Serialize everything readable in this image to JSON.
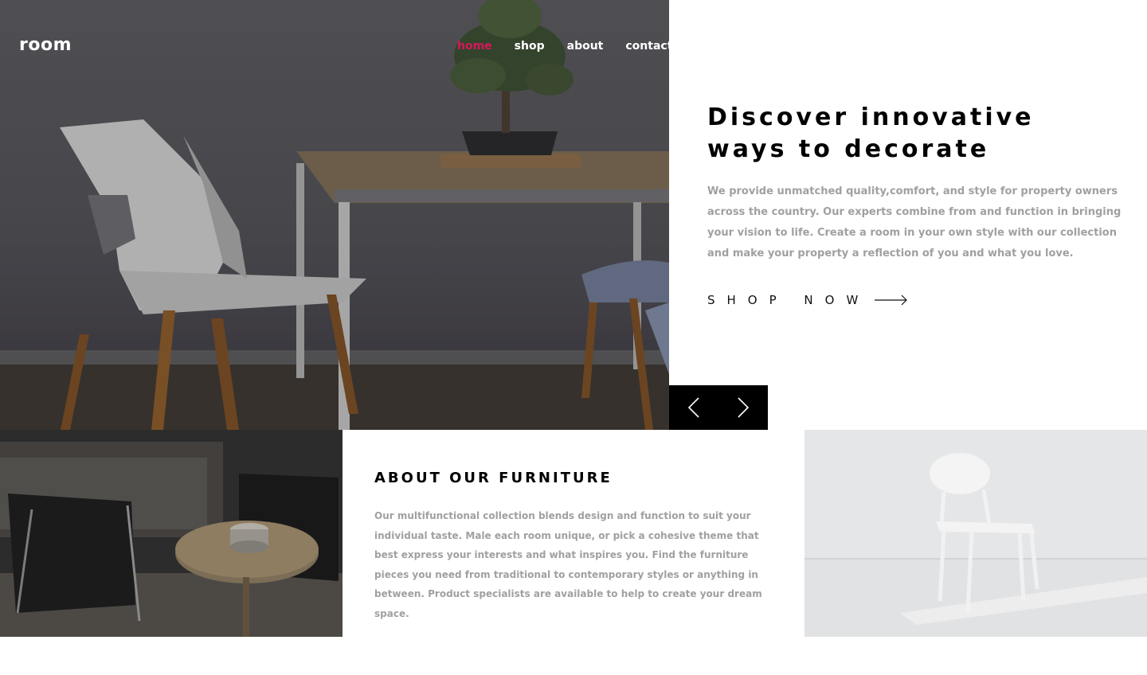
{
  "header": {
    "logo": "room",
    "nav": [
      {
        "label": "home",
        "active": true
      },
      {
        "label": "shop",
        "active": false
      },
      {
        "label": "about",
        "active": false
      },
      {
        "label": "contact",
        "active": false
      }
    ]
  },
  "hero": {
    "headline": "Discover innovative ways to decorate",
    "description": "We provide unmatched quality,comfort, and style for property owners across the country. Our experts combine from and function in bringing your vision to life. Create a room in your own style with our collection and make your property a reflection of you and what you love.",
    "cta": "SHOP NOW",
    "icons": {
      "cta": "arrow-right-icon",
      "prev": "chevron-left-icon",
      "next": "chevron-right-icon"
    }
  },
  "about": {
    "title": "ABOUT OUR FURNITURE",
    "description": "Our multifunctional collection blends design and function to suit your individual taste. Male each room unique, or pick a cohesive theme that best express your interests and what inspires you. Find the furniture pieces you need from traditional to contemporary styles or anything in between. Product specialists are available to help to create your dream space."
  },
  "colors": {
    "accent": "#d6175a",
    "text_dark": "#000000",
    "text_muted": "#a0a0a0",
    "control_bg": "#000000"
  }
}
